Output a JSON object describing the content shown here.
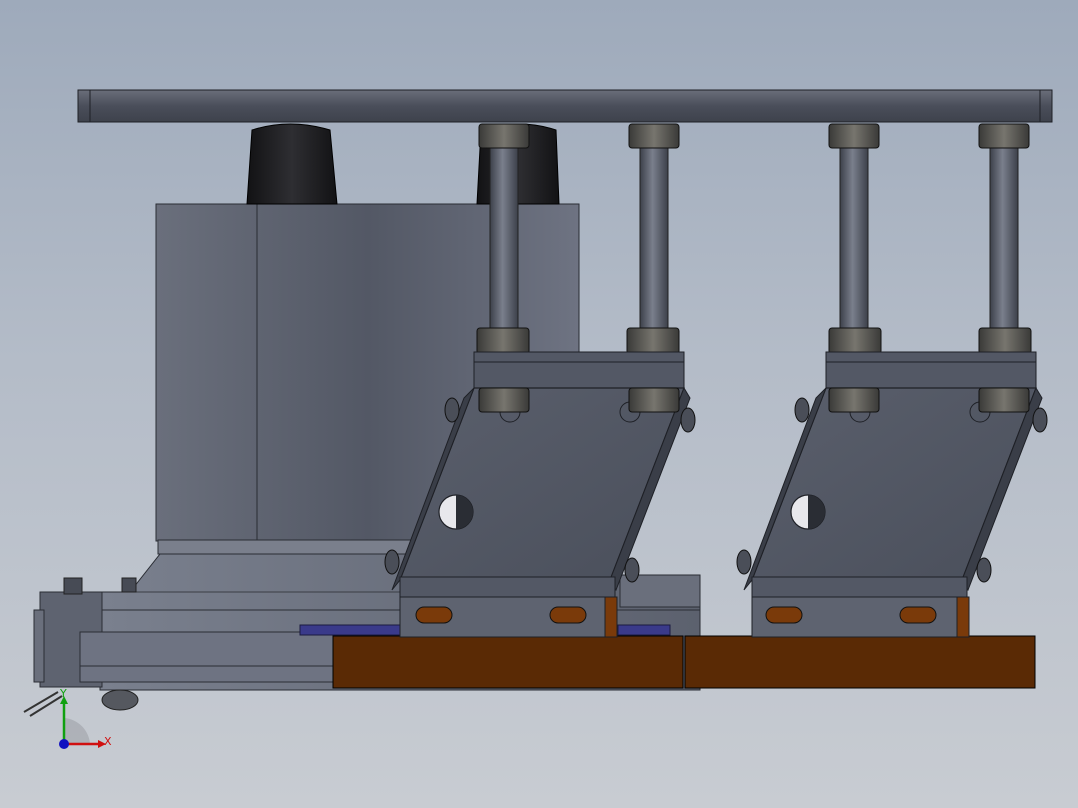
{
  "viewport": {
    "background_top": "#9eaabb",
    "background_bottom": "#c8ccd2"
  },
  "triad": {
    "x_label": "X",
    "y_label": "Y",
    "x_color": "#d01010",
    "y_color": "#10a010",
    "z_color": "#1010c0"
  },
  "colors": {
    "steel_dark": "#4a4e58",
    "steel_mid": "#5e6370",
    "steel_light": "#8a8f9c",
    "rubber": "#1e1e22",
    "wood": "#5a2a05",
    "slot": "#7a3a0a",
    "blue_plate": "#3a3a8a"
  }
}
